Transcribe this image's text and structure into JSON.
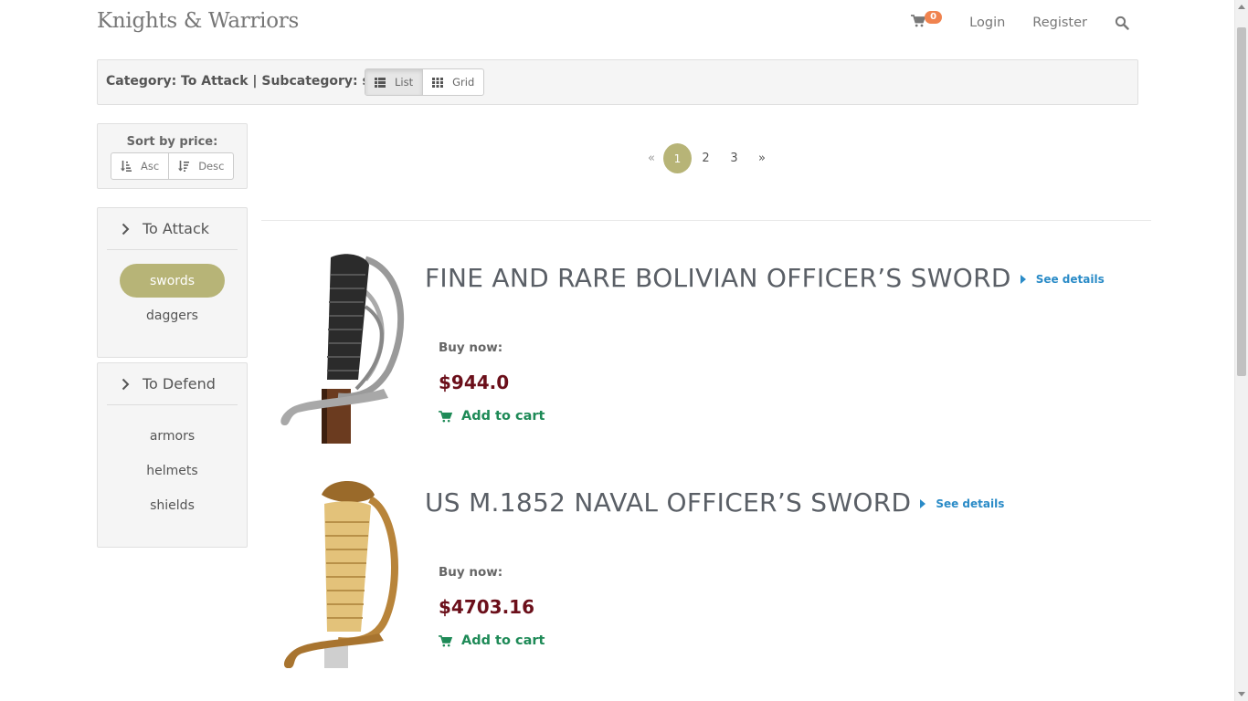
{
  "header": {
    "brand": "Knights & Warriors",
    "cart_count": "0",
    "login": "Login",
    "register": "Register",
    "icons": {
      "cart": "shopping-cart-icon",
      "search": "search-icon"
    }
  },
  "category_bar": {
    "label": "Category: To Attack | Subcategory: swords",
    "view_list": "List",
    "view_grid": "Grid",
    "active_view": "List"
  },
  "sort": {
    "title": "Sort by price:",
    "asc": "Asc",
    "desc": "Desc"
  },
  "sidebar": {
    "panels": [
      {
        "title": "To Attack",
        "items": [
          {
            "label": "swords",
            "active": true
          },
          {
            "label": "daggers",
            "active": false
          }
        ]
      },
      {
        "title": "To Defend",
        "items": [
          {
            "label": "armors",
            "active": false
          },
          {
            "label": "helmets",
            "active": false
          },
          {
            "label": "shields",
            "active": false
          }
        ]
      }
    ]
  },
  "pagination": {
    "prev": "«",
    "pages": [
      "1",
      "2",
      "3"
    ],
    "current": "1",
    "next": "»"
  },
  "products": [
    {
      "title": "FINE AND RARE BOLIVIAN OFFICER’S SWORD",
      "details": "See details",
      "buy_label": "Buy now:",
      "price": "$944.0",
      "add_to_cart": "Add to cart"
    },
    {
      "title": "US M.1852 NAVAL OFFICER’S SWORD",
      "details": "See details",
      "buy_label": "Buy now:",
      "price": "$4703.16",
      "add_to_cart": "Add to cart"
    }
  ],
  "colors": {
    "accent_olive": "#b7b477",
    "price": "#6b0f1a",
    "add_to_cart": "#1e8a57",
    "link_blue": "#2a8bc7",
    "badge": "#f0834f"
  }
}
